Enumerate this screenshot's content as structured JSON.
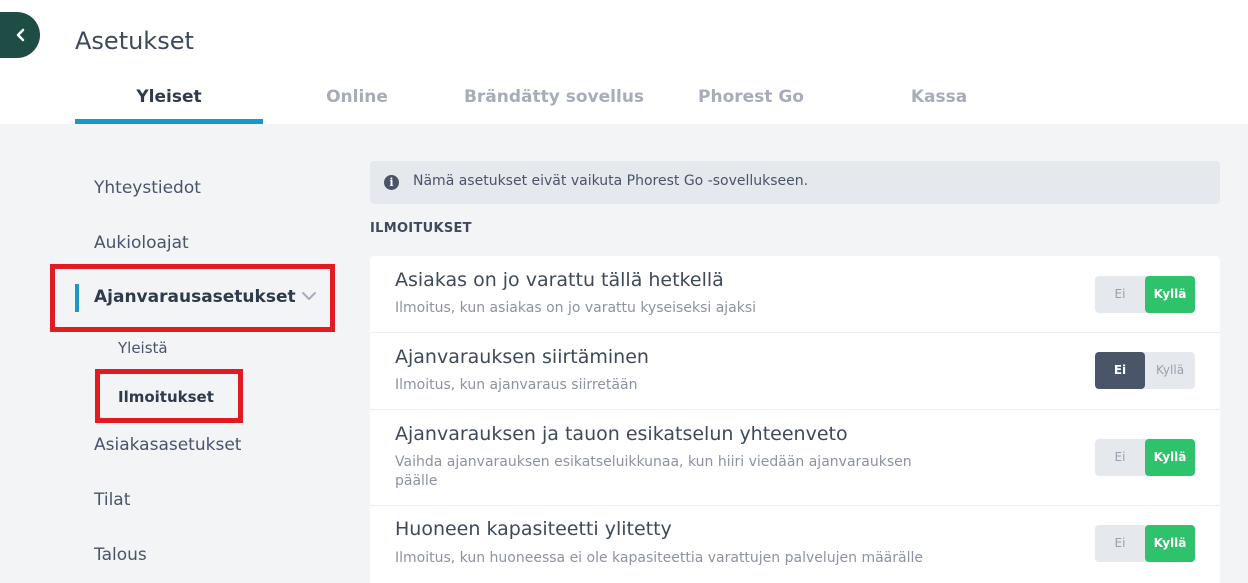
{
  "header": {
    "title": "Asetukset",
    "back_icon": "chevron-left-icon",
    "tabs": [
      {
        "label": "Yleiset",
        "active": true
      },
      {
        "label": "Online",
        "active": false
      },
      {
        "label": "Brändätty sovellus",
        "active": false
      },
      {
        "label": "Phorest Go",
        "active": false
      },
      {
        "label": "Kassa",
        "active": false
      }
    ]
  },
  "sidebar": {
    "items": [
      {
        "label": "Yhteystiedot"
      },
      {
        "label": "Aukioloajat"
      },
      {
        "label": "Ajanvarausasetukset",
        "expanded": true
      },
      {
        "label": "Asiakasasetukset"
      },
      {
        "label": "Tilat"
      },
      {
        "label": "Talous"
      }
    ],
    "subitems": [
      {
        "label": "Yleistä",
        "active": false
      },
      {
        "label": "Ilmoitukset",
        "active": true
      }
    ]
  },
  "main": {
    "info": "Nämä asetukset eivät vaikuta Phorest Go -sovellukseen.",
    "section_title": "ILMOITUKSET",
    "settings": [
      {
        "title": "Asiakas on jo varattu tällä hetkellä",
        "description": "Ilmoitus, kun asiakas on jo varattu kyseiseksi ajaksi",
        "value": "Kyllä"
      },
      {
        "title": "Ajanvarauksen siirtäminen",
        "description": "Ilmoitus, kun ajanvaraus siirretään",
        "value": "Ei"
      },
      {
        "title": "Ajanvarauksen ja tauon esikatselun yhteenveto",
        "description": "Vaihda ajanvarauksen esikatseluikkunaa, kun hiiri viedään ajanvarauksen päälle",
        "value": "Kyllä"
      },
      {
        "title": "Huoneen kapasiteetti ylitetty",
        "description": "Ilmoitus, kun huoneessa ei ole kapasiteettia varattujen palvelujen määrälle",
        "value": "Kyllä"
      }
    ],
    "toggle": {
      "off_label": "Ei",
      "on_label": "Kyllä"
    }
  },
  "colors": {
    "accent": "#1a97c9",
    "on": "#2ec26b",
    "off_selected": "#4a5569",
    "highlight": "#e01b22",
    "back_button": "#1e4d46"
  }
}
